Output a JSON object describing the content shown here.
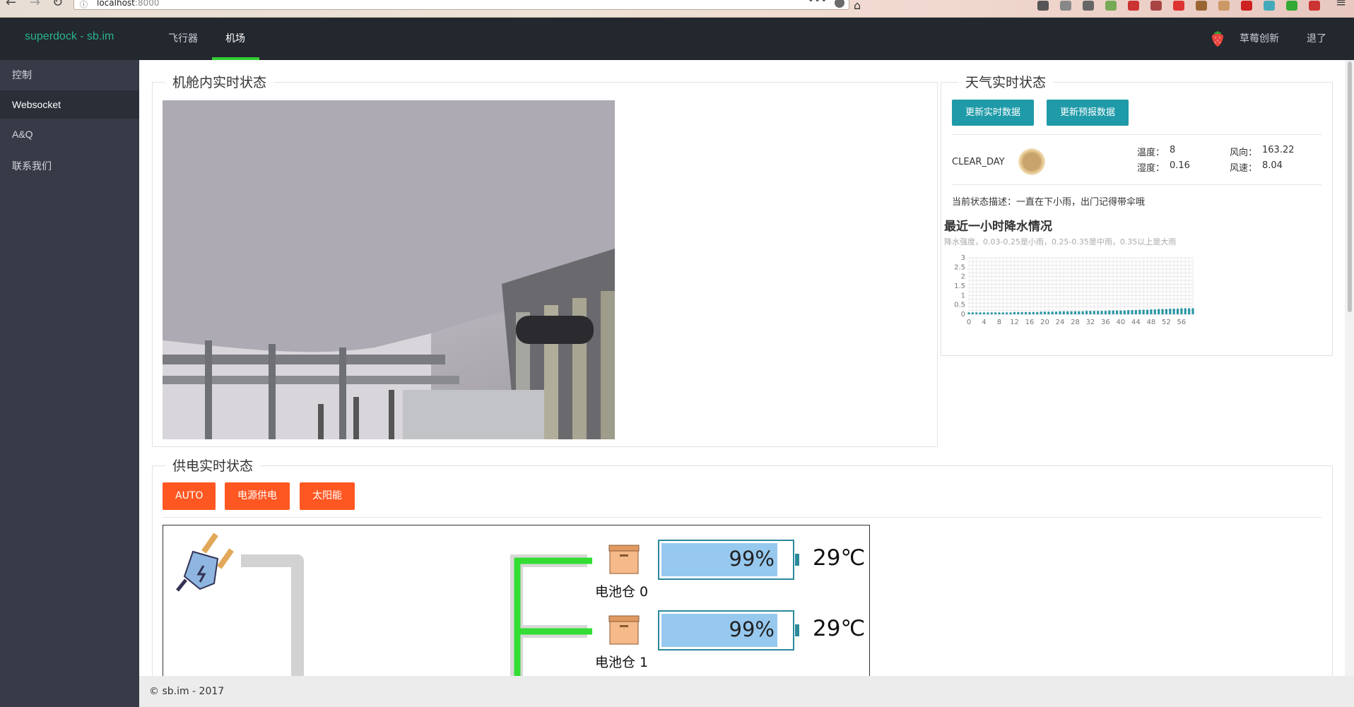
{
  "browser": {
    "url_host": "localhost",
    "url_port": ":8000"
  },
  "navbar": {
    "brand": "superdock - sb.im",
    "tabs": [
      {
        "label": "飞行器"
      },
      {
        "label": "机场"
      }
    ],
    "company": "草莓创新",
    "logout": "退了"
  },
  "sidebar": {
    "items": [
      {
        "label": "控制"
      },
      {
        "label": "Websocket"
      },
      {
        "label": "A&Q"
      },
      {
        "label": "联系我们"
      }
    ]
  },
  "cabin": {
    "title": "机舱内实时状态"
  },
  "weather": {
    "title": "天气实时状态",
    "btn_realtime": "更新实时数据",
    "btn_forecast": "更新预报数据",
    "condition": "CLEAR_DAY",
    "temp_label": "温度：",
    "temp_value": "8",
    "humidity_label": "湿度：",
    "humidity_value": "0.16",
    "wind_dir_label": "风向：",
    "wind_dir_value": "163.22",
    "wind_speed_label": "风速：",
    "wind_speed_value": "8.04",
    "description": "当前状态描述：一直在下小雨，出门记得带伞哦",
    "precip_title": "最近一小时降水情况",
    "precip_sub": "降水强度，0.03-0.25是小雨，0.25-0.35是中雨，0.35以上是大雨"
  },
  "chart_data": {
    "type": "bar",
    "x": [
      0,
      1,
      2,
      3,
      4,
      5,
      6,
      7,
      8,
      9,
      10,
      11,
      12,
      13,
      14,
      15,
      16,
      17,
      18,
      19,
      20,
      21,
      22,
      23,
      24,
      25,
      26,
      27,
      28,
      29,
      30,
      31,
      32,
      33,
      34,
      35,
      36,
      37,
      38,
      39,
      40,
      41,
      42,
      43,
      44,
      45,
      46,
      47,
      48,
      49,
      50,
      51,
      52,
      53,
      54,
      55,
      56,
      57,
      58,
      59
    ],
    "values": [
      0.1,
      0.1,
      0.1,
      0.1,
      0.1,
      0.1,
      0.1,
      0.1,
      0.1,
      0.1,
      0.1,
      0.1,
      0.12,
      0.12,
      0.12,
      0.12,
      0.12,
      0.12,
      0.12,
      0.14,
      0.14,
      0.14,
      0.14,
      0.14,
      0.16,
      0.16,
      0.16,
      0.16,
      0.16,
      0.16,
      0.16,
      0.18,
      0.18,
      0.18,
      0.18,
      0.18,
      0.18,
      0.2,
      0.2,
      0.2,
      0.2,
      0.2,
      0.22,
      0.22,
      0.22,
      0.24,
      0.24,
      0.24,
      0.26,
      0.26,
      0.28,
      0.28,
      0.28,
      0.3,
      0.3,
      0.3,
      0.32,
      0.32,
      0.32,
      0.32
    ],
    "xticks": [
      "0",
      "4",
      "8",
      "12",
      "16",
      "20",
      "24",
      "28",
      "32",
      "36",
      "40",
      "44",
      "48",
      "52",
      "56"
    ],
    "yticks": [
      "0",
      "0.5",
      "1",
      "1.5",
      "2",
      "2.5",
      "3"
    ],
    "ylim": [
      0,
      3
    ],
    "grid": true,
    "color": "#2a96a6"
  },
  "power": {
    "title": "供电实时状态",
    "buttons": [
      {
        "label": "AUTO"
      },
      {
        "label": "电源供电"
      },
      {
        "label": "太阳能"
      }
    ],
    "bays": [
      {
        "label": "电池仓 0",
        "percent": "99%",
        "fill": 0.99,
        "temp": "29℃"
      },
      {
        "label": "电池仓 1",
        "percent": "99%",
        "fill": 0.99,
        "temp": "29℃"
      }
    ]
  },
  "footer": {
    "text": "© sb.im - 2017"
  }
}
